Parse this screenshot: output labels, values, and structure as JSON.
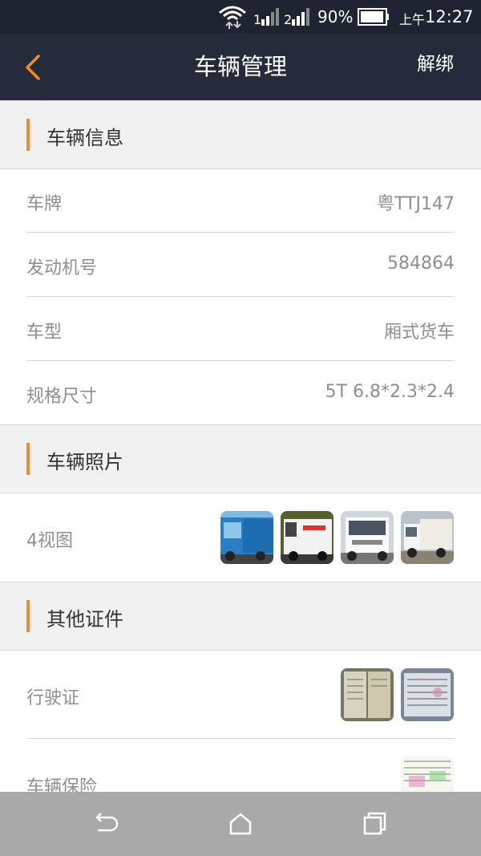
{
  "status_bar": {
    "sim1": "1",
    "sim2": "2",
    "battery": "90%",
    "time_prefix": "上午",
    "time": "12:27"
  },
  "header": {
    "title": "车辆管理",
    "action": "解绑"
  },
  "vehicle_info": {
    "section_title": "车辆信息",
    "rows": [
      {
        "label": "车牌",
        "value": "粤TTJ147"
      },
      {
        "label": "发动机号",
        "value": "584864"
      },
      {
        "label": "车型",
        "value": "厢式货车"
      },
      {
        "label": "规格尺寸",
        "value": "5T 6.8*2.3*2.4"
      }
    ]
  },
  "photos": {
    "section_title": "车辆照片",
    "label": "4视图"
  },
  "certs": {
    "section_title": "其他证件",
    "rows": [
      {
        "label": "行驶证"
      },
      {
        "label": "车辆保险"
      }
    ]
  },
  "colors": {
    "header_bg": "#252b3a",
    "accent": "#f08c2d",
    "nav_bg": "#a9a9a9"
  }
}
